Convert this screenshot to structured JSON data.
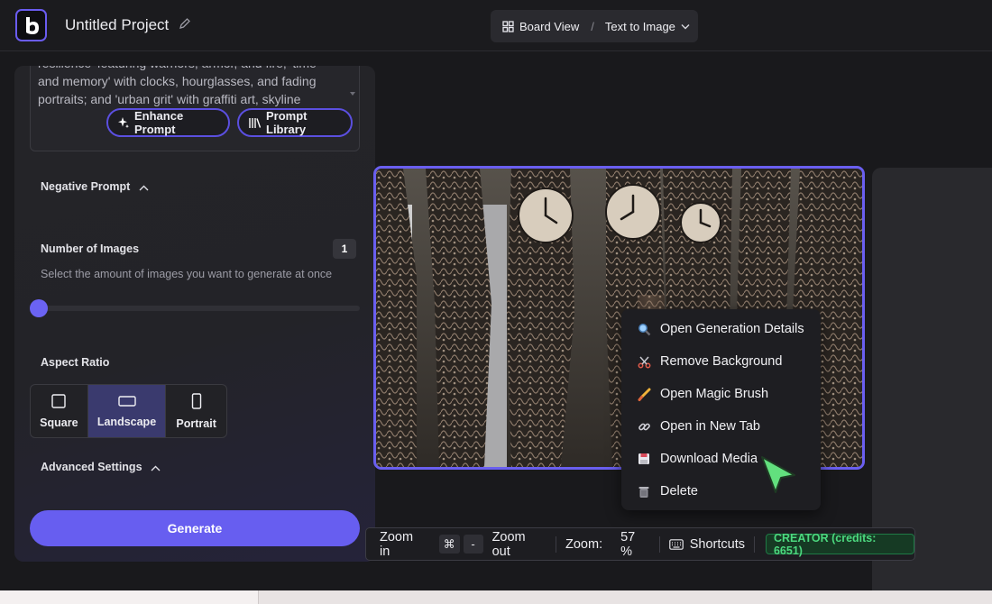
{
  "header": {
    "project_title": "Untitled Project",
    "view_label": "Board View",
    "separator": "/",
    "mode_label": "Text to Image"
  },
  "prompt": {
    "text": "resilience' featuring warriors, armor, and fire; 'time and memory' with clocks, hourglasses, and fading portraits; and 'urban grit' with graffiti art, skyline",
    "enhance_label": "Enhance Prompt",
    "library_label": "Prompt Library"
  },
  "settings": {
    "negative_prompt_label": "Negative Prompt",
    "num_images_label": "Number of Images",
    "num_images_value": "1",
    "num_images_help": "Select the amount of images you want to generate at once",
    "aspect_ratio_label": "Aspect Ratio",
    "aspect_options": [
      "Square",
      "Landscape",
      "Portrait"
    ],
    "aspect_selected": "Landscape",
    "advanced_label": "Advanced Settings",
    "generate_label": "Generate"
  },
  "context_menu": {
    "items": [
      {
        "label": "Open Generation Details",
        "icon": "magnifier-icon"
      },
      {
        "label": "Remove Background",
        "icon": "scissors-icon"
      },
      {
        "label": "Open Magic Brush",
        "icon": "brush-icon"
      },
      {
        "label": "Open in New Tab",
        "icon": "link-icon"
      },
      {
        "label": "Download Media",
        "icon": "floppy-disk-icon"
      },
      {
        "label": "Delete",
        "icon": "trash-icon"
      }
    ]
  },
  "toolbar": {
    "zoom_in_label": "Zoom in",
    "cmd_key": "⌘",
    "minus_key": "-",
    "zoom_out_label": "Zoom out",
    "zoom_label": "Zoom:",
    "zoom_value": "57 %",
    "shortcuts_label": "Shortcuts",
    "plan_badge": "CREATOR (credits: 6651)"
  },
  "colors": {
    "accent": "#675ef0",
    "selected_aspect": "#3a3a6e",
    "credits_green": "#4cd97f",
    "cursor_green": "#62e07e"
  }
}
